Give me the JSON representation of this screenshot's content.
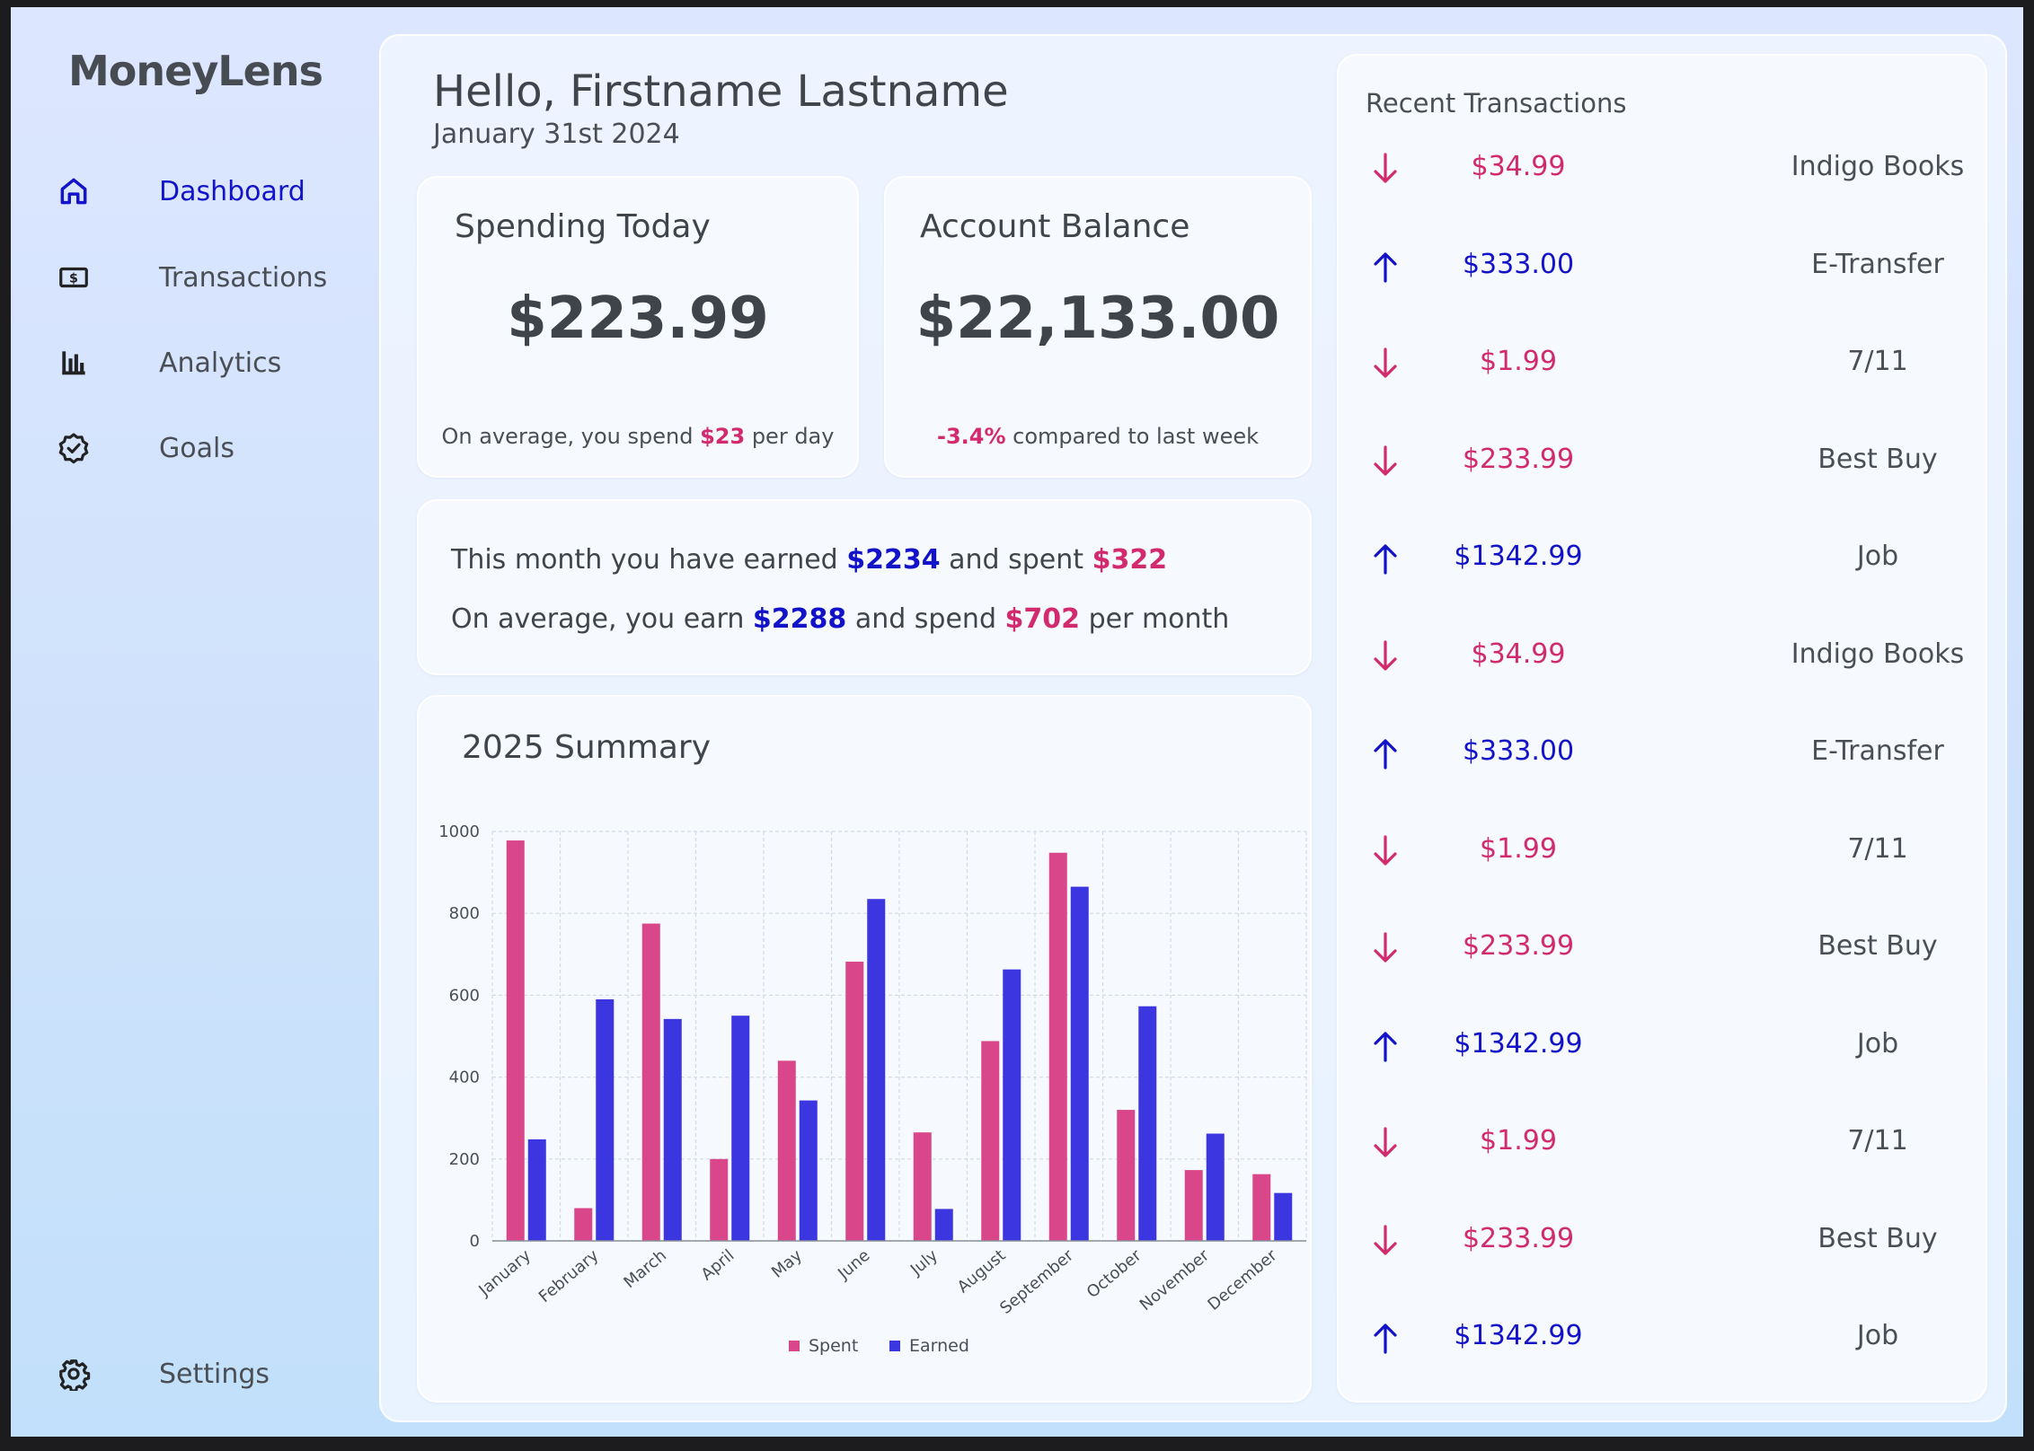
{
  "app": {
    "brand": "MoneyLens"
  },
  "sidebar": {
    "items": [
      {
        "label": "Dashboard",
        "icon": "home-icon",
        "active": true
      },
      {
        "label": "Transactions",
        "icon": "dollar-bill-icon",
        "active": false
      },
      {
        "label": "Analytics",
        "icon": "bar-chart-icon",
        "active": false
      },
      {
        "label": "Goals",
        "icon": "badge-check-icon",
        "active": false
      }
    ],
    "settings_label": "Settings"
  },
  "header": {
    "greeting": "Hello, Firstname Lastname",
    "date": "January 31st 2024"
  },
  "spending_today": {
    "title": "Spending Today",
    "amount": "$223.99",
    "note_prefix": "On average, you spend ",
    "note_value": "$23",
    "note_suffix": " per day"
  },
  "account_balance": {
    "title": "Account Balance",
    "amount": "$22,133.00",
    "note_value": "-3.4%",
    "note_suffix": " compared to last week"
  },
  "monthly": {
    "line1_prefix": "This month you have earned ",
    "line1_earned": "$2234",
    "line1_mid": " and spent ",
    "line1_spent": "$322",
    "line2_prefix": "On average, you earn ",
    "line2_earned": "$2288",
    "line2_mid": " and spend ",
    "line2_spent": "$702",
    "line2_suffix": " per month"
  },
  "summary": {
    "title": "2025 Summary"
  },
  "chart_data": {
    "type": "bar",
    "categories": [
      "January",
      "February",
      "March",
      "April",
      "May",
      "June",
      "July",
      "August",
      "September",
      "October",
      "November",
      "December"
    ],
    "series": [
      {
        "name": "Spent",
        "color": "#d9478a",
        "values": [
          978,
          80,
          775,
          200,
          440,
          682,
          265,
          488,
          948,
          320,
          173,
          163
        ]
      },
      {
        "name": "Earned",
        "color": "#3b36e0",
        "values": [
          248,
          590,
          542,
          550,
          343,
          835,
          78,
          663,
          865,
          573,
          262,
          117
        ]
      }
    ],
    "yticks": [
      0,
      200,
      400,
      600,
      800,
      1000
    ],
    "ylim": [
      0,
      1000
    ],
    "grid": true,
    "legend": "bottom"
  },
  "colors": {
    "spent": "#d12a6e",
    "earned": "#1212c8",
    "accent": "#1313c9"
  },
  "transactions": {
    "title": "Recent Transactions",
    "items": [
      {
        "direction": "down",
        "amount": "$34.99",
        "merchant": "Indigo Books"
      },
      {
        "direction": "up",
        "amount": "$333.00",
        "merchant": "E-Transfer"
      },
      {
        "direction": "down",
        "amount": "$1.99",
        "merchant": "7/11"
      },
      {
        "direction": "down",
        "amount": "$233.99",
        "merchant": "Best Buy"
      },
      {
        "direction": "up",
        "amount": "$1342.99",
        "merchant": "Job"
      },
      {
        "direction": "down",
        "amount": "$34.99",
        "merchant": "Indigo Books"
      },
      {
        "direction": "up",
        "amount": "$333.00",
        "merchant": "E-Transfer"
      },
      {
        "direction": "down",
        "amount": "$1.99",
        "merchant": "7/11"
      },
      {
        "direction": "down",
        "amount": "$233.99",
        "merchant": "Best Buy"
      },
      {
        "direction": "up",
        "amount": "$1342.99",
        "merchant": "Job"
      },
      {
        "direction": "down",
        "amount": "$1.99",
        "merchant": "7/11"
      },
      {
        "direction": "down",
        "amount": "$233.99",
        "merchant": "Best Buy"
      },
      {
        "direction": "up",
        "amount": "$1342.99",
        "merchant": "Job"
      }
    ]
  }
}
